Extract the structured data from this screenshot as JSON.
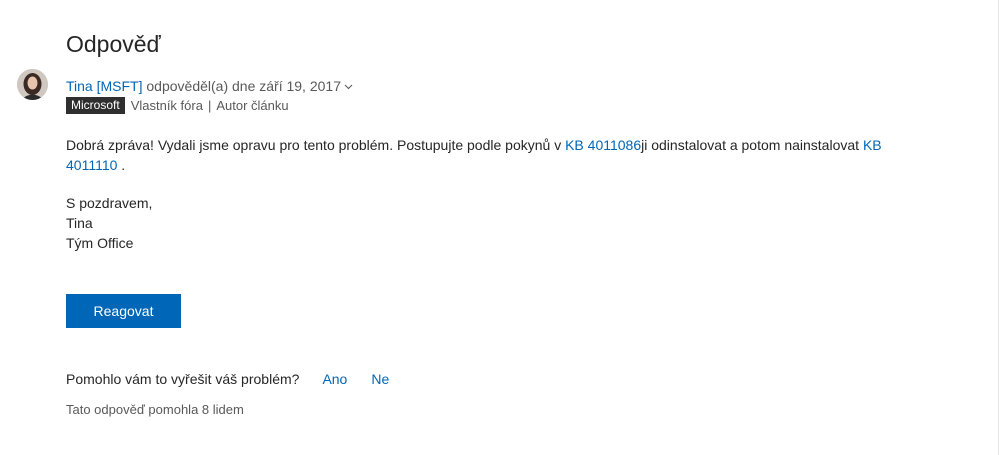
{
  "answer_title": "Odpověď",
  "author": {
    "name": "Tina [MSFT]",
    "action": " odpověděl(a) dne září 19, 2017",
    "badge": "Microsoft",
    "role": "Vlastník fóra",
    "separator": "|",
    "role2": "Autor článku"
  },
  "message": {
    "part1": "Dobrá zpráva! Vydali jsme opravu pro tento problém.  Postupujte podle pokynů v ",
    "link1": "KB 4011086",
    "part2": "ji odinstalovat a potom nainstalovat ",
    "link2": "KB 4011110",
    "part3": " ."
  },
  "signature": {
    "line1": "S pozdravem,",
    "line2": "Tina",
    "line3": "Tým Office"
  },
  "reply_button": "Reagovat",
  "helpful": {
    "question": "Pomohlo vám to vyřešit váš problém?",
    "yes": "Ano",
    "no": "Ne"
  },
  "helped_count": "Tato odpověď pomohla 8 lidem",
  "colors": {
    "link": "#0067b8",
    "button": "#0067b8",
    "badge": "#2f2f2f"
  }
}
